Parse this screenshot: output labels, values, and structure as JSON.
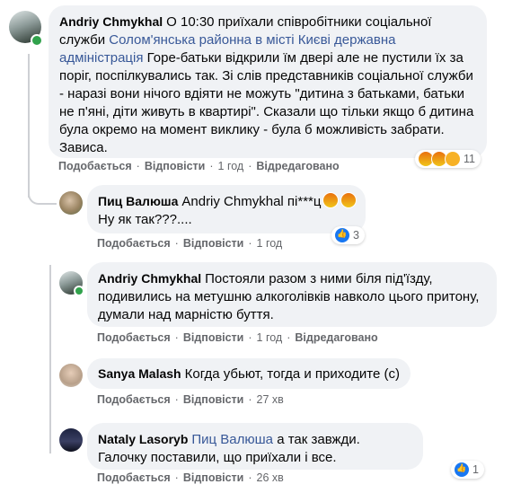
{
  "comments": [
    {
      "author": "Andriy Chmykhal",
      "text_pre": "О 10:30 приїхали співробітники соціальної служби ",
      "mention": "Солом'янська районна в місті Києві державна адміністрація",
      "text_post": " Горе-батьки відкрили їм двері але не пустили їх за поріг, поспілкувались так. Зі слів представників соціальної служби - наразі вони нічого вдіяти не можуть \"дитина з батьками, батьки не п'яні, діти живуть в квартирі\". Сказали що тільки якщо б дитина була окремо на момент виклику - була б можливість забрати. Зависа.",
      "like_label": "Подобається",
      "reply_label": "Відповісти",
      "time": "1 год",
      "edited": "Відредаговано",
      "reaction_count": "11"
    },
    {
      "author": "Пиц Валюша",
      "mention": "Andriy Chmykhal",
      "text_pre": " пі***ц",
      "text_post": "Ну як так???....",
      "like_label": "Подобається",
      "reply_label": "Відповісти",
      "time": "1 год",
      "reaction_count": "3"
    },
    {
      "author": "Andriy Chmykhal",
      "text": "Постояли разом з ними біля під'їзду, подивились на метушню алкоголівків навколо цього притону, думали над марністю буття.",
      "like_label": "Подобається",
      "reply_label": "Відповісти",
      "time": "1 год",
      "edited": "Відредаговано"
    },
    {
      "author": "Sanya Malash",
      "text": "Когда убьют, тогда и приходите (с)",
      "like_label": "Подобається",
      "reply_label": "Відповісти",
      "time": "27 хв"
    },
    {
      "author": "Nataly Lasoryb",
      "mention": "Пиц Валюша",
      "text": " а так завжди. Галочку поставили, що приїхали і все.",
      "like_label": "Подобається",
      "reply_label": "Відповісти",
      "time": "26 хв",
      "reaction_count": "1"
    }
  ],
  "colors": {
    "bubble": "#f0f2f5",
    "link": "#385898",
    "meta": "#65676b",
    "online": "#31a24c",
    "like": "#1877f2"
  },
  "icons": [
    "angry-reaction-icon",
    "wow-reaction-icon",
    "like-reaction-icon",
    "online-status-icon"
  ]
}
